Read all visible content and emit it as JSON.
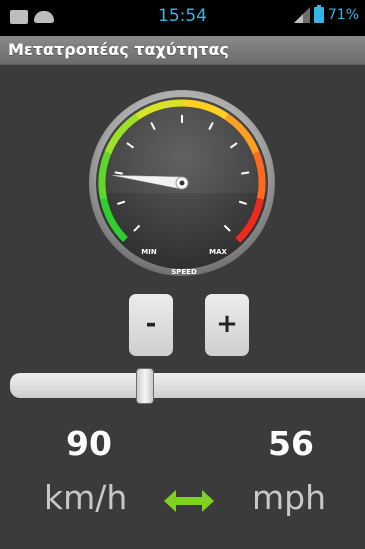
{
  "status_bar": {
    "time": "15:54",
    "battery": "71%",
    "accent": "#33b5e5"
  },
  "app": {
    "title": "Μετατροπέας ταχύτητας"
  },
  "gauge": {
    "min_label": "MIN",
    "max_label": "MAX",
    "caption": "SPEED",
    "needle_level": 0.19
  },
  "buttons": {
    "minus": "-",
    "plus": "+"
  },
  "slider": {
    "level": 0.38
  },
  "values": {
    "left_value": "90",
    "left_unit": "km/h",
    "right_value": "56",
    "right_unit": "mph"
  },
  "icons": {
    "swap": "double-arrow-icon",
    "swap_color": "#7ed321"
  }
}
